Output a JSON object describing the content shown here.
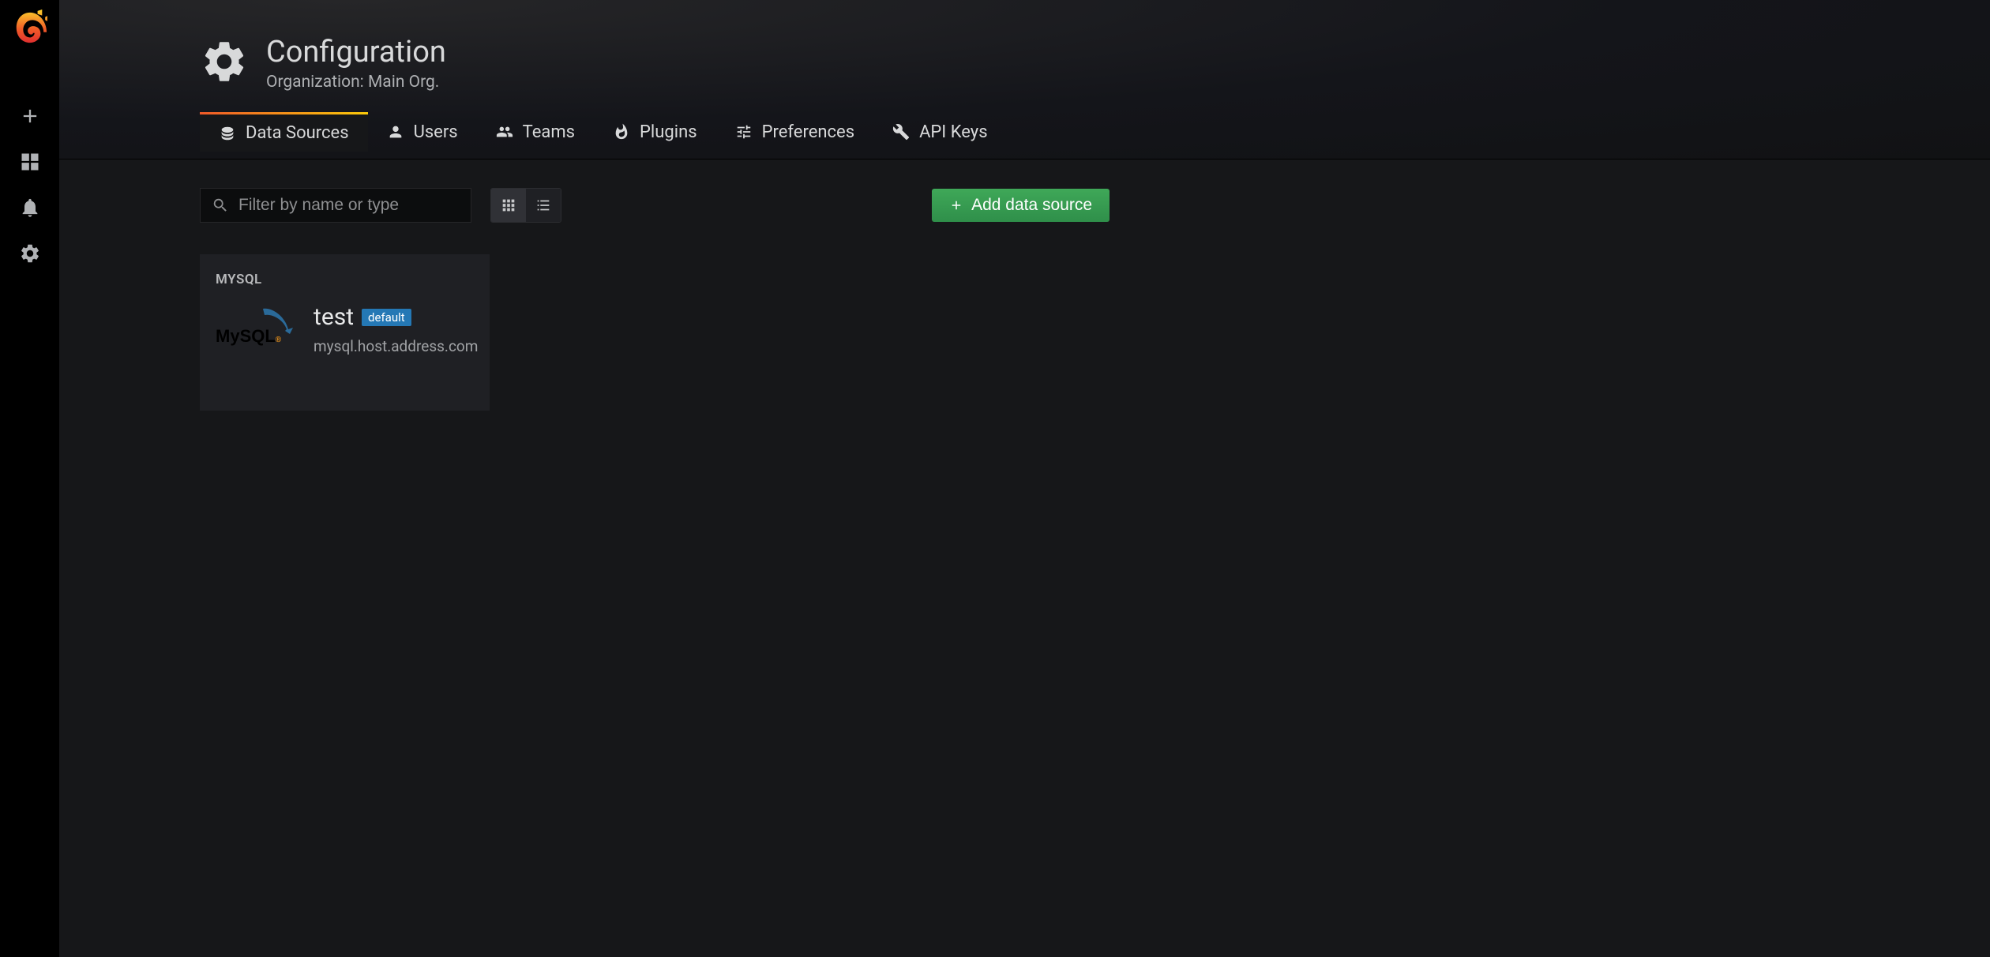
{
  "header": {
    "title": "Configuration",
    "subtitle": "Organization: Main Org."
  },
  "tabs": [
    {
      "label": "Data Sources",
      "icon": "database-icon",
      "active": true
    },
    {
      "label": "Users",
      "icon": "user-icon",
      "active": false
    },
    {
      "label": "Teams",
      "icon": "users-icon",
      "active": false
    },
    {
      "label": "Plugins",
      "icon": "plug-icon",
      "active": false
    },
    {
      "label": "Preferences",
      "icon": "sliders-icon",
      "active": false
    },
    {
      "label": "API Keys",
      "icon": "key-icon",
      "active": false
    }
  ],
  "search": {
    "placeholder": "Filter by name or type",
    "value": ""
  },
  "add_button_label": "Add data source",
  "datasources": [
    {
      "kind": "MYSQL",
      "name": "test",
      "badge": "default",
      "url": "mysql.host.address.com"
    }
  ]
}
